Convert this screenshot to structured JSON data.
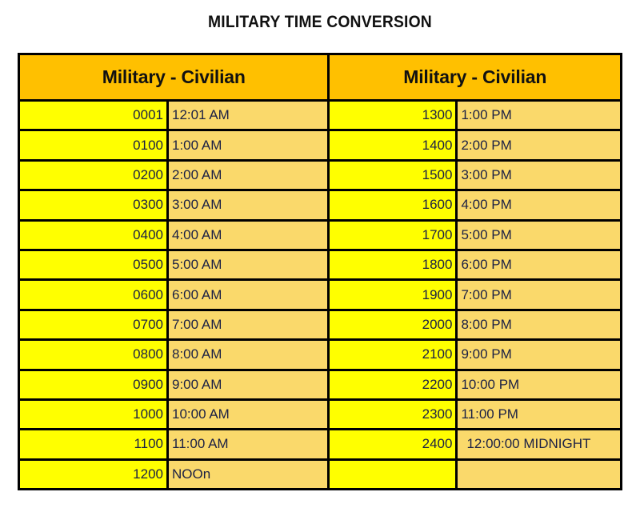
{
  "title": "MILITARY TIME CONVERSION",
  "colors": {
    "header_orange": "#FFC000",
    "military_yellow": "#FFFF00",
    "civilian_gold": "#FAD96B",
    "border_black": "#000000",
    "text_navy": "#1B2044",
    "page_background": "#FFFFFF"
  },
  "table": {
    "columns": [
      {
        "header": "Military - Civilian",
        "sub_headers": [
          "Military",
          "Civilian"
        ],
        "rows": [
          {
            "military": "0001",
            "civilian": "12:01 AM"
          },
          {
            "military": "0100",
            "civilian": "1:00 AM"
          },
          {
            "military": "0200",
            "civilian": "2:00 AM"
          },
          {
            "military": "0300",
            "civilian": "3:00 AM"
          },
          {
            "military": "0400",
            "civilian": "4:00 AM"
          },
          {
            "military": "0500",
            "civilian": "5:00 AM"
          },
          {
            "military": "0600",
            "civilian": "6:00 AM"
          },
          {
            "military": "0700",
            "civilian": "7:00 AM"
          },
          {
            "military": "0800",
            "civilian": "8:00 AM"
          },
          {
            "military": "0900",
            "civilian": "9:00 AM"
          },
          {
            "military": "1000",
            "civilian": "10:00 AM"
          },
          {
            "military": "1100",
            "civilian": "11:00 AM"
          },
          {
            "military": "1200",
            "civilian": "NOOn"
          }
        ]
      },
      {
        "header": "Military - Civilian",
        "sub_headers": [
          "Military",
          "Civilian"
        ],
        "rows": [
          {
            "military": "1300",
            "civilian": "1:00 PM"
          },
          {
            "military": "1400",
            "civilian": "2:00 PM"
          },
          {
            "military": "1500",
            "civilian": "3:00 PM"
          },
          {
            "military": "1600",
            "civilian": "4:00 PM"
          },
          {
            "military": "1700",
            "civilian": "5:00 PM"
          },
          {
            "military": "1800",
            "civilian": "6:00 PM"
          },
          {
            "military": "1900",
            "civilian": "7:00 PM"
          },
          {
            "military": "2000",
            "civilian": "8:00 PM"
          },
          {
            "military": "2100",
            "civilian": "9:00 PM"
          },
          {
            "military": "2200",
            "civilian": "10:00 PM"
          },
          {
            "military": "2300",
            "civilian": "11:00 PM"
          },
          {
            "military": "2400",
            "civilian": "12:00:00 MIDNIGHT"
          },
          {
            "military": "",
            "civilian": ""
          }
        ]
      }
    ]
  }
}
